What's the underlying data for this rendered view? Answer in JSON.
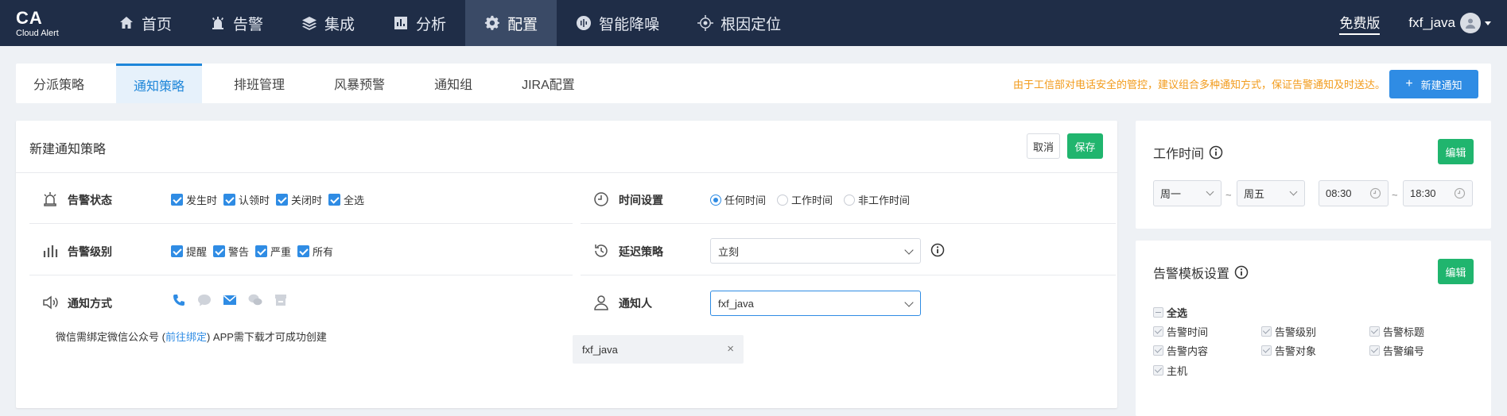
{
  "logo": {
    "title": "CA",
    "subtitle": "Cloud Alert"
  },
  "nav": [
    {
      "label": "首页",
      "icon": "home-icon"
    },
    {
      "label": "告警",
      "icon": "alarm-icon"
    },
    {
      "label": "集成",
      "icon": "layers-icon"
    },
    {
      "label": "分析",
      "icon": "bar-chart-icon"
    },
    {
      "label": "配置",
      "icon": "gear-icon",
      "active": true
    },
    {
      "label": "智能降噪",
      "icon": "noise-reduction-icon"
    },
    {
      "label": "根因定位",
      "icon": "locate-icon"
    }
  ],
  "header_right": {
    "edition": "免费版",
    "username": "fxf_java"
  },
  "tabs": [
    "分派策略",
    "通知策略",
    "排班管理",
    "风暴预警",
    "通知组",
    "JIRA配置"
  ],
  "active_tab": "通知策略",
  "warning": "由于工信部对电话安全的管控，建议组合多种通知方式，保证告警通知及时送达。",
  "new_button": "新建通知",
  "form": {
    "title": "新建通知策略",
    "cancel": "取消",
    "save": "保存",
    "alert_status": {
      "label": "告警状态",
      "options": [
        "发生时",
        "认领时",
        "关闭时",
        "全选"
      ]
    },
    "alert_level": {
      "label": "告警级别",
      "options": [
        "提醒",
        "警告",
        "严重",
        "所有"
      ]
    },
    "notify_method": {
      "label": "通知方式"
    },
    "wechat_note": {
      "before": "微信需绑定微信公众号 (",
      "link": "前往绑定",
      "after": ") APP需下载才可成功创建"
    },
    "time_setting": {
      "label": "时间设置",
      "options": [
        "任何时间",
        "工作时间",
        "非工作时间"
      ],
      "selected": "任何时间"
    },
    "delay_policy": {
      "label": "延迟策略",
      "value": "立刻"
    },
    "notifier": {
      "label": "通知人",
      "value": "fxf_java",
      "tag": "fxf_java"
    }
  },
  "work_time": {
    "title": "工作时间",
    "edit": "编辑",
    "day_from": "周一",
    "day_to": "周五",
    "time_from": "08:30",
    "time_to": "18:30",
    "sep": "~"
  },
  "template": {
    "title": "告警模板设置",
    "edit": "编辑",
    "select_all": "全选",
    "fields": [
      "告警时间",
      "告警级别",
      "告警标题",
      "告警内容",
      "告警对象",
      "告警编号",
      "主机"
    ]
  },
  "colors": {
    "nav_bg": "#1f2d47",
    "primary": "#2f8ce4",
    "success": "#20b56e",
    "warning": "#f29b1b"
  }
}
